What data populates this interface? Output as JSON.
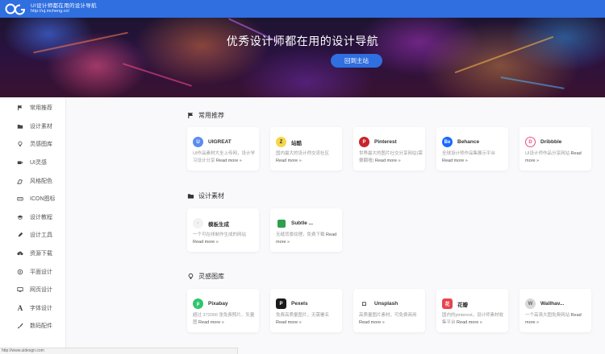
{
  "header": {
    "logo_icon": "ug-logo-icon",
    "site_name": "UI设计师都在用的设计导航",
    "site_url": "http://uj.mcheng.cn/"
  },
  "hero": {
    "title": "优秀设计师都在用的设计导航",
    "button_label": "回到主站",
    "accent": "#2f6fe0"
  },
  "sidebar": {
    "items": [
      {
        "label": "常用推荐",
        "icon": "flag-icon"
      },
      {
        "label": "设计素材",
        "icon": "folder-icon"
      },
      {
        "label": "灵感图库",
        "icon": "lightbulb-icon"
      },
      {
        "label": "UI灵感",
        "icon": "video-icon"
      },
      {
        "label": "风格配色",
        "icon": "palette-icon"
      },
      {
        "label": "ICON图标",
        "icon": "keyboard-icon"
      },
      {
        "label": "设计教程",
        "icon": "graduation-cap-icon"
      },
      {
        "label": "设计工具",
        "icon": "pencil-icon"
      },
      {
        "label": "资源下载",
        "icon": "cloud-download-icon"
      },
      {
        "label": "平面设计",
        "icon": "compass-icon"
      },
      {
        "label": "网页设计",
        "icon": "monitor-icon"
      },
      {
        "label": "字体设计",
        "icon": "font-icon"
      },
      {
        "label": "数码配件",
        "icon": "brush-icon"
      }
    ]
  },
  "sections": [
    {
      "title": "常用推荐",
      "icon": "flag-icon",
      "cards": [
        {
          "name": "UIGREAT",
          "desc": "UI作品素材大全上传网，设计学习设计分享",
          "more": "Read more »",
          "logo_color": "#5b8cf0",
          "logo_text": "U"
        },
        {
          "name": "站酷",
          "desc": "国内最大的设计师交流社区",
          "more": "Read more »",
          "logo_color": "#f7d64a",
          "logo_text": "Z"
        },
        {
          "name": "Pinterest",
          "desc": "世界最大的图片社交分享网站(需要翻墙)",
          "more": "Read more »",
          "logo_color": "#c8232c",
          "logo_text": "P"
        },
        {
          "name": "Behance",
          "desc": "全球设计师作品集展示平台",
          "more": "Read more »",
          "logo_color": "#1769ff",
          "logo_text": "Be"
        },
        {
          "name": "Dribbble",
          "desc": "UI设计师作品分享网站",
          "more": "Read more »",
          "logo_color": "#ea4c89",
          "logo_text": "D"
        }
      ]
    },
    {
      "title": "设计素材",
      "icon": "folder-icon",
      "cards": [
        {
          "name": "模板生成",
          "desc": "一个可在线制作生成的网站",
          "more": "Read more »",
          "logo_color": "#e0e0e0",
          "logo_text": "·"
        },
        {
          "name": "Subtle ...",
          "desc": "无缝背景纹理，免费下载",
          "more": "Read more »",
          "logo_color": "#2e9e4f",
          "logo_text": "■"
        }
      ]
    },
    {
      "title": "灵感图库",
      "icon": "lightbulb-icon",
      "cards": [
        {
          "name": "Pixabay",
          "desc": "超过 372000 张免费照片、矢量图",
          "more": "Read more »",
          "logo_color": "#2ec66d",
          "logo_text": "p"
        },
        {
          "name": "Pexels",
          "desc": "免费高质量图片，无需署名",
          "more": "Read more »",
          "logo_color": "#1a1a1a",
          "logo_text": "P"
        },
        {
          "name": "Unsplash",
          "desc": "高质量图片素材，可免费商用",
          "more": "Read more »",
          "logo_color": "#ffffff",
          "logo_text": "◘"
        },
        {
          "name": "花瓣",
          "desc": "国内的pinterest，设计师素材收集平台",
          "more": "Read more »",
          "logo_color": "#e8444e",
          "logo_text": "花"
        },
        {
          "name": "Wallhav...",
          "desc": "一个高清大图免费网站",
          "more": "Read more »",
          "logo_color": "#cfcfcf",
          "logo_text": "W"
        }
      ]
    }
  ],
  "statusbar": {
    "text": "http://www.uidesgn.com"
  }
}
